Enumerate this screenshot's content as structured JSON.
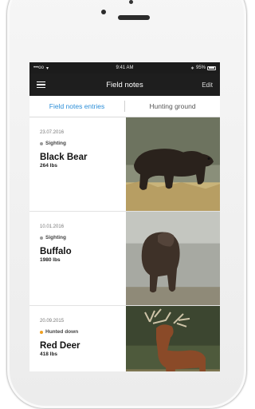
{
  "status_bar": {
    "carrier": "•••oo",
    "time": "9:41 AM",
    "battery": "95%"
  },
  "navbar": {
    "title": "Field notes",
    "edit_label": "Edit"
  },
  "tabs": [
    {
      "label": "Field notes entries",
      "active": true
    },
    {
      "label": "Hunting ground",
      "active": false
    }
  ],
  "entries": [
    {
      "date": "23.07.2016",
      "type": "Sighting",
      "type_color": "#9a9a9a",
      "name": "Black Bear",
      "weight": "264 lbs",
      "photo": "bear-photo"
    },
    {
      "date": "10.01.2016",
      "type": "Sighting",
      "type_color": "#9a9a9a",
      "name": "Buffalo",
      "weight": "1980 lbs",
      "photo": "buffalo-photo"
    },
    {
      "date": "20.09.2015",
      "type": "Hunted down",
      "type_color": "#f0a020",
      "name": "Red Deer",
      "weight": "418 lbs",
      "photo": "deer-photo"
    }
  ],
  "colors": {
    "accent": "#2d8fd8",
    "navbar": "#1e1e1e"
  }
}
